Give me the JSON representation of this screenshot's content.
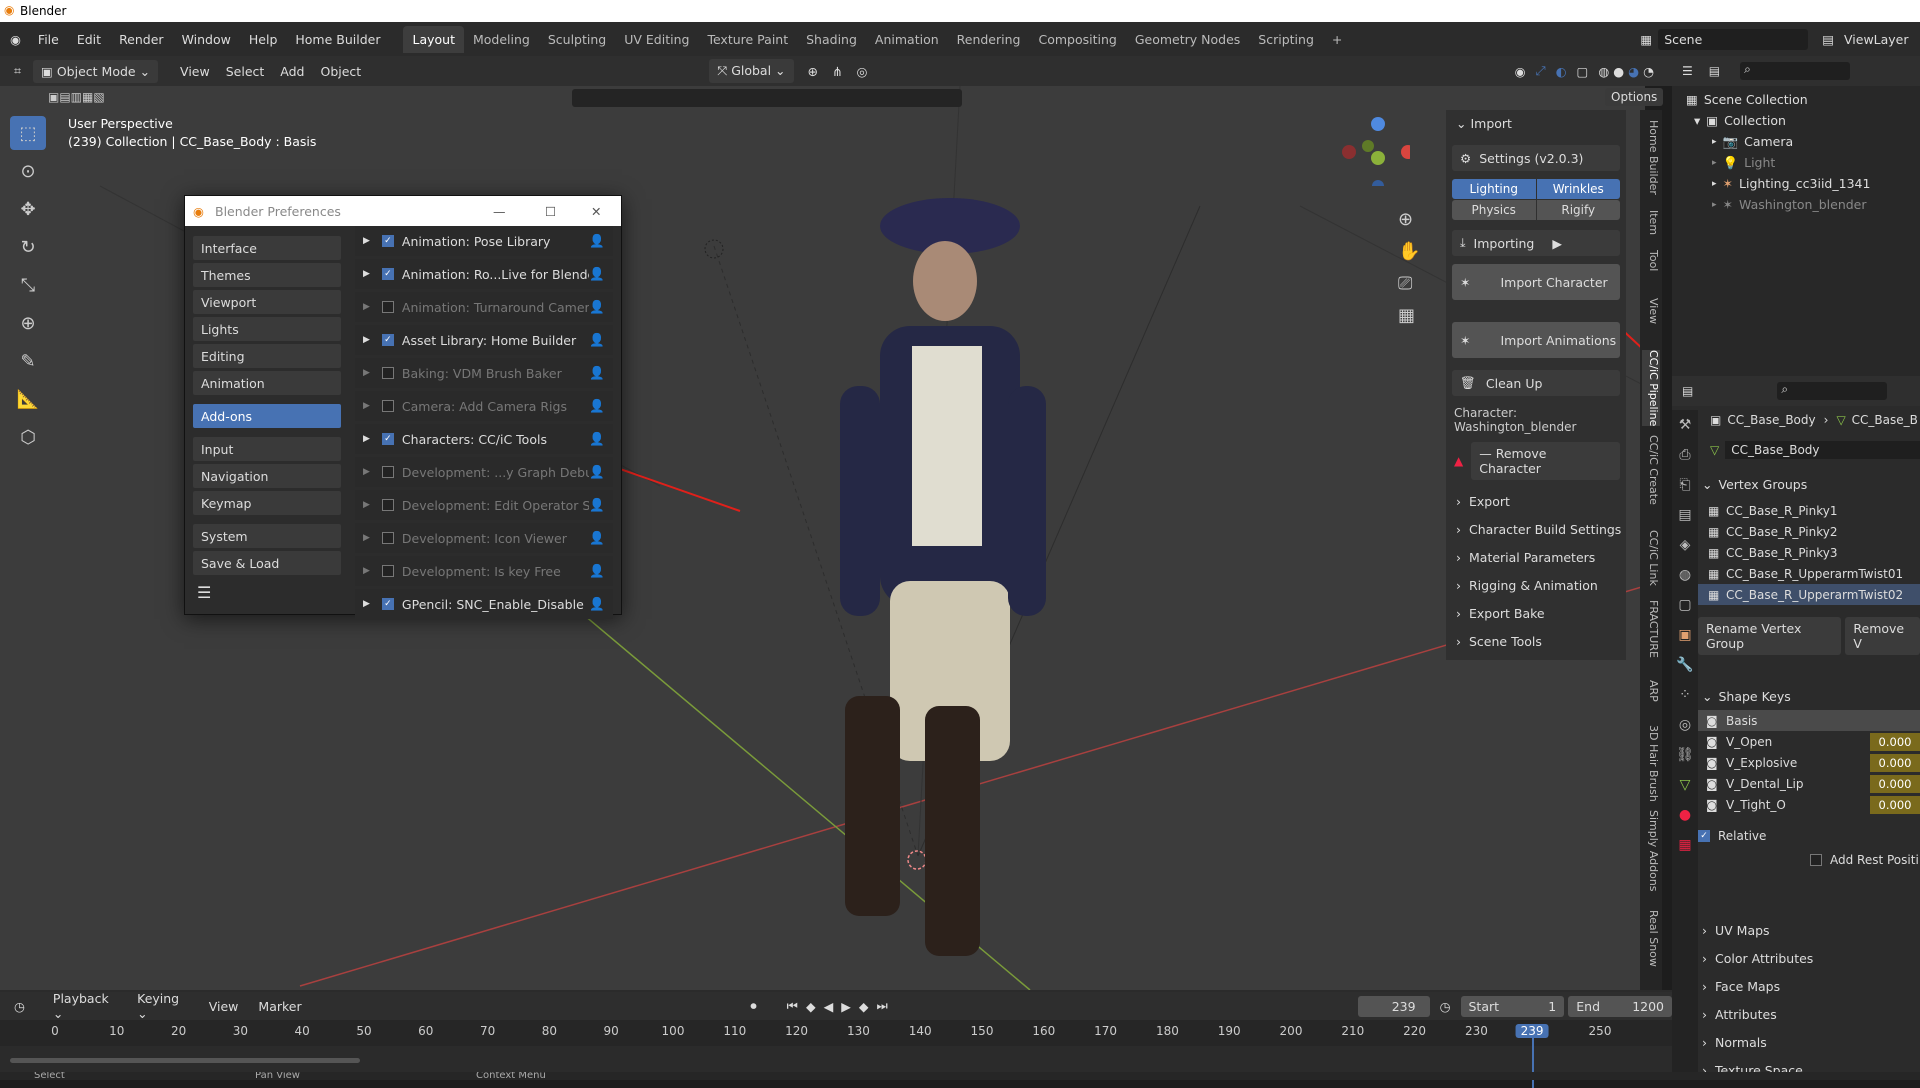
{
  "app": {
    "title": "Blender"
  },
  "menu": {
    "items": [
      "File",
      "Edit",
      "Render",
      "Window",
      "Help",
      "Home Builder"
    ]
  },
  "workspaces": [
    "Layout",
    "Modeling",
    "Sculpting",
    "UV Editing",
    "Texture Paint",
    "Shading",
    "Animation",
    "Rendering",
    "Compositing",
    "Geometry Nodes",
    "Scripting"
  ],
  "scene": {
    "label": "Scene",
    "view_layer": "ViewLayer"
  },
  "header": {
    "mode": "Object Mode",
    "menus": [
      "View",
      "Select",
      "Add",
      "Object"
    ],
    "transform": "Global",
    "options": "Options"
  },
  "viewport": {
    "perspective": "User Perspective",
    "info": "(239) Collection | CC_Base_Body : Basis"
  },
  "preferences": {
    "title": "Blender Preferences",
    "categories": [
      "Interface",
      "Themes",
      "Viewport",
      "Lights",
      "Editing",
      "Animation",
      "Add-ons",
      "Input",
      "Navigation",
      "Keymap",
      "System",
      "Save & Load"
    ],
    "active_category": "Add-ons",
    "addons": [
      {
        "name": "Animation: Pose Library",
        "enabled": true
      },
      {
        "name": "Animation: Ro...Live for Blender",
        "enabled": true
      },
      {
        "name": "Animation: Turnaround Camera",
        "enabled": false
      },
      {
        "name": "Asset Library: Home Builder",
        "enabled": true
      },
      {
        "name": "Baking: VDM Brush Baker",
        "enabled": false
      },
      {
        "name": "Camera: Add Camera Rigs",
        "enabled": false
      },
      {
        "name": "Characters: CC/iC Tools",
        "enabled": true
      },
      {
        "name": "Development: ...y Graph Debug",
        "enabled": false
      },
      {
        "name": "Development: Edit Operator S...",
        "enabled": false
      },
      {
        "name": "Development: Icon Viewer",
        "enabled": false
      },
      {
        "name": "Development: Is key Free",
        "enabled": false
      },
      {
        "name": "GPencil: SNC_Enable_Disable",
        "enabled": true
      }
    ]
  },
  "npanel": {
    "import_label": "Import",
    "settings": "Settings (v2.0.3)",
    "toggles": [
      "Lighting",
      "Wrinkles",
      "Physics",
      "Rigify"
    ],
    "importing": "Importing",
    "import_character": "Import Character",
    "import_animations": "Import Animations",
    "clean_up": "Clean Up",
    "character": "Character: Washington_blender",
    "remove_character": "Remove Character",
    "sections": [
      "Export",
      "Character Build Settings",
      "Material Parameters",
      "Rigging & Animation",
      "Export Bake",
      "Scene Tools"
    ]
  },
  "vtabs": [
    "Home Builder",
    "Item",
    "Tool",
    "View",
    "CC/iC Pipeline",
    "CC/iC Create",
    "CC/iC Link",
    "FRACTURE",
    "ARP",
    "3D Hair Brush",
    "Simply Addons",
    "Real Snow"
  ],
  "outliner": {
    "root": "Scene Collection",
    "collection": "Collection",
    "items": [
      "Camera",
      "Light",
      "Lighting_cc3iid_1341",
      "Washington_blender"
    ]
  },
  "properties": {
    "object": "CC_Base_Body",
    "mesh": "CC_Base_B",
    "data_name": "CC_Base_Body",
    "vertex_groups_label": "Vertex Groups",
    "vertex_groups": [
      "CC_Base_R_Pinky1",
      "CC_Base_R_Pinky2",
      "CC_Base_R_Pinky3",
      "CC_Base_R_UpperarmTwist01",
      "CC_Base_R_UpperarmTwist02"
    ],
    "rename_vg": "Rename Vertex Group",
    "remove_vg": "Remove V",
    "shape_keys_label": "Shape Keys",
    "shape_keys": [
      {
        "name": "Basis",
        "value": ""
      },
      {
        "name": "V_Open",
        "value": "0.000"
      },
      {
        "name": "V_Explosive",
        "value": "0.000"
      },
      {
        "name": "V_Dental_Lip",
        "value": "0.000"
      },
      {
        "name": "V_Tight_O",
        "value": "0.000"
      }
    ],
    "relative": "Relative",
    "add_rest": "Add Rest Positi",
    "sections": [
      "UV Maps",
      "Color Attributes",
      "Face Maps",
      "Attributes",
      "Normals",
      "Texture Space"
    ]
  },
  "timeline": {
    "menus": [
      "Playback",
      "Keying",
      "View",
      "Marker"
    ],
    "current_frame": "239",
    "start_label": "Start",
    "start": "1",
    "end_label": "End",
    "end": "1200",
    "ticks": [
      "0",
      "10",
      "20",
      "30",
      "40",
      "50",
      "60",
      "70",
      "80",
      "90",
      "100",
      "110",
      "120",
      "130",
      "140",
      "150",
      "160",
      "170",
      "180",
      "190",
      "200",
      "210",
      "220",
      "230",
      "239",
      "250"
    ]
  },
  "statusbar": {
    "select": "Select",
    "pan": "Pan View",
    "context": "Context Menu"
  },
  "colors": {
    "accent": "#4772b3",
    "shape_value": "#7a6a1c",
    "annotation": "#e0201a"
  }
}
